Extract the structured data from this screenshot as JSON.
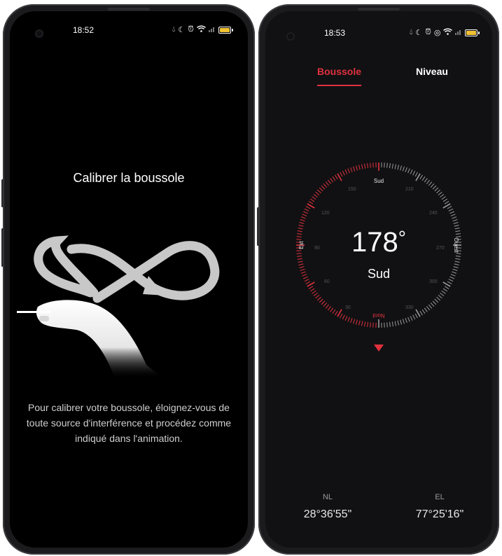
{
  "left_screen": {
    "status_time": "18:52",
    "title": "Calibrer la boussole",
    "instructions": "Pour calibrer votre boussole, éloignez-vous de toute source d'interférence et procédez comme indiqué dans l'animation."
  },
  "right_screen": {
    "status_time": "18:53",
    "tabs": [
      {
        "label": "Boussole",
        "active": true
      },
      {
        "label": "Niveau",
        "active": false
      }
    ],
    "heading": {
      "degrees": "178",
      "unit": "°",
      "direction": "Sud"
    },
    "dial_labels": {
      "top": "Sud",
      "left": "Est",
      "right": "Ouest",
      "bottom": "Nord"
    },
    "dial_numbers": [
      "150",
      "120",
      "90",
      "60",
      "30",
      "210",
      "240",
      "270",
      "300",
      "330"
    ],
    "coordinates": {
      "lat_label": "NL",
      "lat_value": "28°36'55\"",
      "lon_label": "EL",
      "lon_value": "77°25'16\""
    }
  },
  "colors": {
    "accent": "#e0313e",
    "background": "#000000",
    "battery": "#f1c232"
  }
}
